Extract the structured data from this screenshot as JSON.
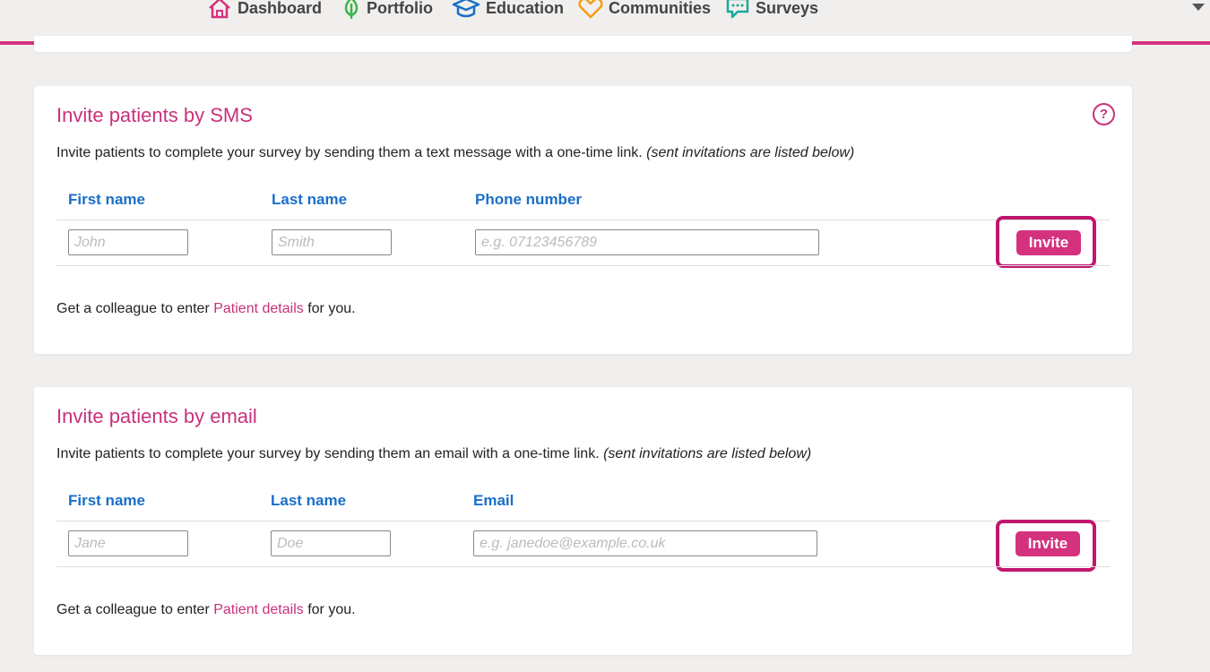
{
  "nav": {
    "items": [
      {
        "label": "Dashboard",
        "icon": "home-icon",
        "color": "#d4317f"
      },
      {
        "label": "Portfolio",
        "icon": "leaf-icon",
        "color": "#3bb54a"
      },
      {
        "label": "Education",
        "icon": "graduation-cap-icon",
        "color": "#1a6fc8"
      },
      {
        "label": "Communities",
        "icon": "heart-icon",
        "color": "#f39c12"
      },
      {
        "label": "Surveys",
        "icon": "chat-bubble-icon",
        "color": "#1aa89a"
      }
    ],
    "accent": "#d4317f"
  },
  "sms": {
    "title": "Invite patients by SMS",
    "description": "Invite patients to complete your survey by sending them a text message with a one-time link.",
    "note": "(sent invitations are listed below)",
    "columns": [
      "First name",
      "Last name",
      "Phone number"
    ],
    "placeholders": {
      "first": "John",
      "last": "Smith",
      "phone": "e.g. 07123456789"
    },
    "invite_label": "Invite",
    "colleague_prefix": "Get a colleague to enter ",
    "colleague_link": "Patient details",
    "colleague_suffix": " for you.",
    "help": "?"
  },
  "email": {
    "title": "Invite patients by email",
    "description": "Invite patients to complete your survey by sending them an email with a one-time link.",
    "note": "(sent invitations are listed below)",
    "columns": [
      "First name",
      "Last name",
      "Email"
    ],
    "placeholders": {
      "first": "Jane",
      "last": "Doe",
      "email": "e.g. janedoe@example.co.uk"
    },
    "invite_label": "Invite",
    "colleague_prefix": "Get a colleague to enter ",
    "colleague_link": "Patient details",
    "colleague_suffix": " for you."
  }
}
